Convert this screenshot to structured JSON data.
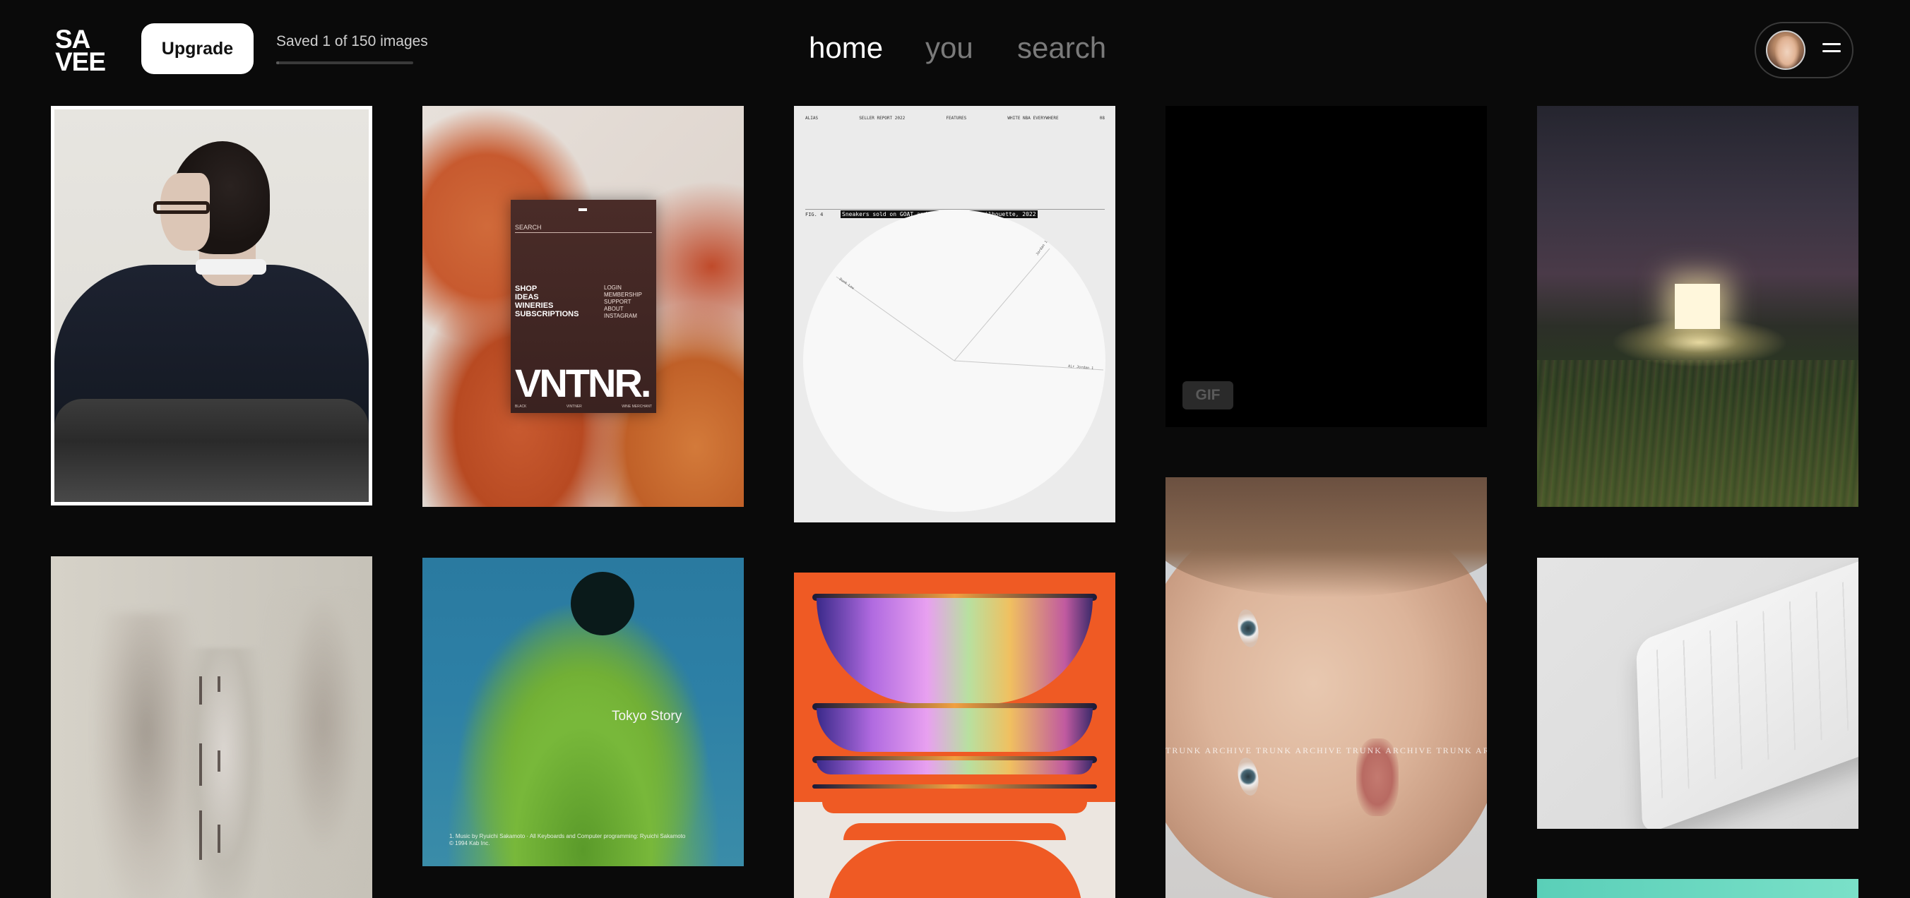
{
  "header": {
    "logo_line1": "SA",
    "logo_line2": "VEE",
    "upgrade_label": "Upgrade",
    "saved_text": "Saved 1 of 150 images",
    "saved_progress": 0.0067,
    "nav": [
      {
        "label": "home",
        "active": true
      },
      {
        "label": "you",
        "active": false
      },
      {
        "label": "search",
        "active": false
      }
    ],
    "menu_icon": "hamburger-icon",
    "avatar_icon": "user-avatar"
  },
  "tiles": {
    "vntnr": {
      "search": "SEARCH",
      "menu_left": [
        "SHOP",
        "IDEAS",
        "WINERIES",
        "SUBSCRIPTIONS"
      ],
      "menu_right": [
        "LOGIN",
        "MEMBERSHIP",
        "SUPPORT",
        "ABOUT",
        "INSTAGRAM"
      ],
      "brand": "VNTNR.",
      "footer_left": "BLACK",
      "footer_mid": "VINTNER",
      "footer_right": "WINE MERCHANT"
    },
    "sneakers": {
      "top_items": [
        "ALIAS",
        "SELLER REPORT 2022",
        "FEATURES",
        "WHITE NBA EVERYWHERE",
        "08"
      ],
      "fig_label": "FIG. 4",
      "caption": "Sneakers sold on GOAT and Flight Club by silhouette, 2022",
      "slice_labels": [
        "Dunk Low",
        "Jordan 1",
        "Air Jordan 1"
      ]
    },
    "gif_badge": "GIF",
    "tokyo": {
      "title": "Tokyo Story",
      "credit_line1": "1. Music by Ryuichi Sakamoto · All Keyboards and Computer programming: Ryuichi Sakamoto",
      "credit_line2": "© 1994 Kab Inc."
    },
    "trunk_watermark": "TRUNK ARCHIVE     TRUNK ARCHIVE     TRUNK ARCHIVE     TRUNK ARCHIVE     TRUNK ARCHIVE"
  }
}
